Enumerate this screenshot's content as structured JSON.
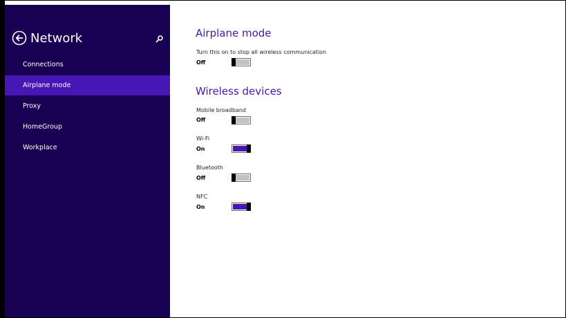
{
  "sidebar": {
    "title": "Network",
    "back_icon": "back-arrow-circle-icon",
    "search_icon": "search-icon",
    "items": [
      {
        "label": "Connections",
        "active": false
      },
      {
        "label": "Airplane mode",
        "active": true
      },
      {
        "label": "Proxy",
        "active": false
      },
      {
        "label": "HomeGroup",
        "active": false
      },
      {
        "label": "Workplace",
        "active": false
      }
    ]
  },
  "main": {
    "airplane": {
      "heading": "Airplane mode",
      "description": "Turn this on to stop all wireless communication",
      "state": "Off"
    },
    "wireless": {
      "heading": "Wireless devices",
      "devices": [
        {
          "label": "Mobile broadband",
          "state": "Off"
        },
        {
          "label": "Wi-Fi",
          "state": "On"
        },
        {
          "label": "Bluetooth",
          "state": "Off"
        },
        {
          "label": "NFC",
          "state": "On"
        }
      ]
    }
  },
  "colors": {
    "sidebar_bg": "#180052",
    "accent": "#4617b4",
    "toggle_off_fill": "#c2c2c2"
  }
}
